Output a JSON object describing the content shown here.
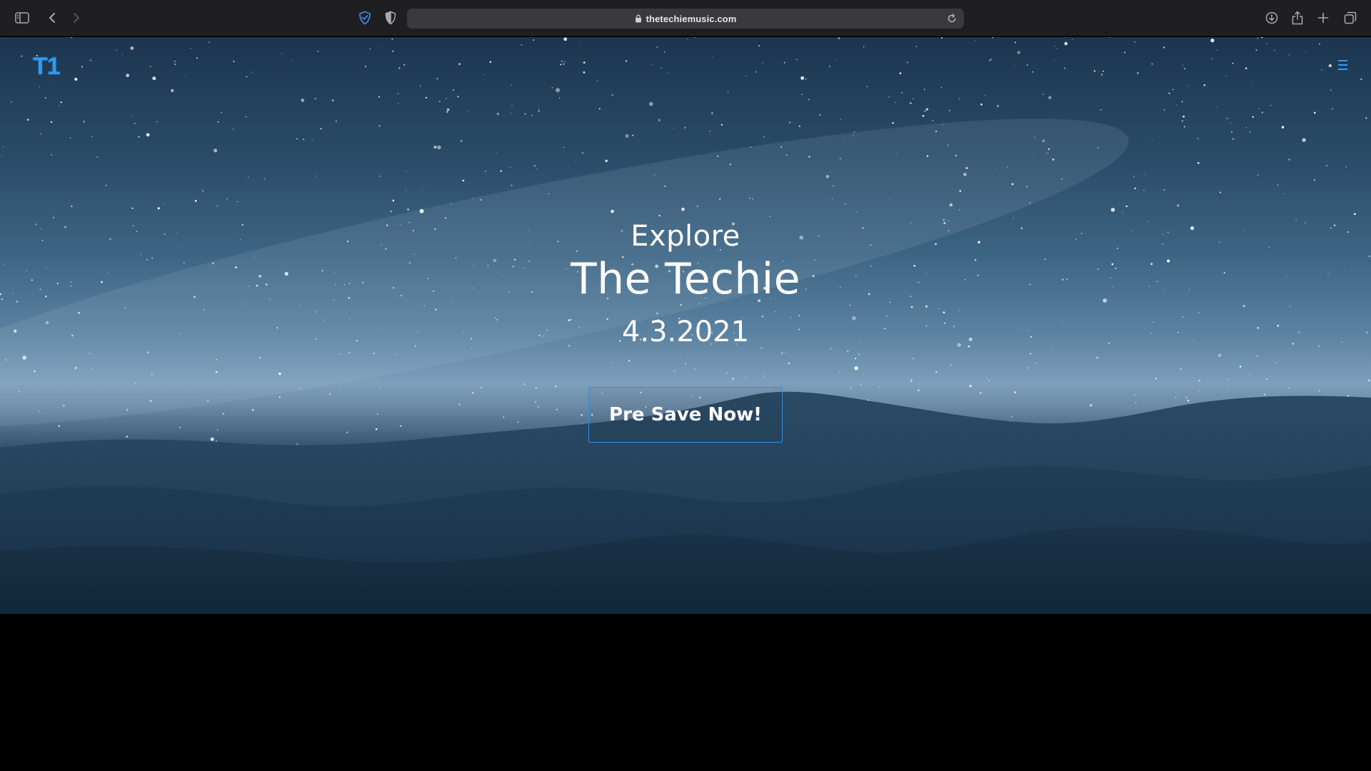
{
  "browser": {
    "url": "thetechiemusic.com",
    "icons": {
      "sidebar": "sidebar-icon",
      "back": "chevron-left-icon",
      "forward": "chevron-right-icon",
      "privacy": "shield-check-icon",
      "tracking": "half-shield-icon",
      "lock": "lock-icon",
      "reload": "reload-icon",
      "downloads": "download-icon",
      "share": "share-icon",
      "new_tab": "plus-icon",
      "tabs": "tab-overview-icon"
    }
  },
  "site": {
    "logo": "T1",
    "menu_icon": "hamburger-icon",
    "hero": {
      "eyebrow": "Explore",
      "headline": "The Techie",
      "release_date": "4.3.2021",
      "cta_label": "Pre Save Now!"
    }
  },
  "colors": {
    "accent": "#2f9cf0",
    "chrome": "#1f1f21",
    "address_bar": "#3a3a3c",
    "text": "#ffffff"
  }
}
